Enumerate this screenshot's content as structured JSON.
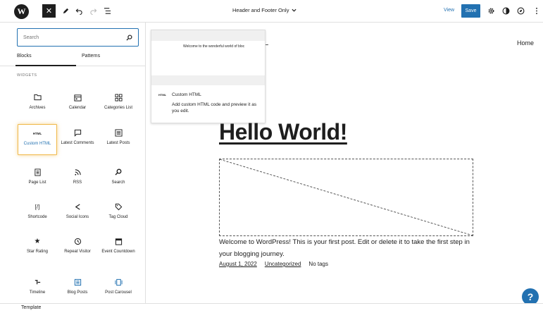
{
  "toolbar": {
    "logo_letter": "W",
    "close_symbol": "✕",
    "template_title": "Header and Footer Only",
    "view_label": "View",
    "save_label": "Save"
  },
  "inserter": {
    "search_placeholder": "Search",
    "tabs": [
      "Blocks",
      "Patterns"
    ],
    "section_title": "WIDGETS",
    "blocks": [
      {
        "label": "Archives",
        "icon": "folder-icon"
      },
      {
        "label": "Calendar",
        "icon": "calendar-icon"
      },
      {
        "label": "Categories List",
        "icon": "grid-icon"
      },
      {
        "label": "Custom HTML",
        "icon": "html-icon",
        "selected": true
      },
      {
        "label": "Latest Comments",
        "icon": "comment-icon"
      },
      {
        "label": "Latest Posts",
        "icon": "list-icon"
      },
      {
        "label": "Page List",
        "icon": "pages-icon"
      },
      {
        "label": "RSS",
        "icon": "rss-icon"
      },
      {
        "label": "Search",
        "icon": "search-icon"
      },
      {
        "label": "Shortcode",
        "icon": "shortcode-icon"
      },
      {
        "label": "Social Icons",
        "icon": "share-icon"
      },
      {
        "label": "Tag Cloud",
        "icon": "tag-icon"
      },
      {
        "label": "Star Rating",
        "icon": "star-icon"
      },
      {
        "label": "Repeat Visitor",
        "icon": "history-icon"
      },
      {
        "label": "Event Countdown",
        "icon": "event-icon"
      },
      {
        "label": "Timeline",
        "icon": "timeline-icon"
      },
      {
        "label": "Blog Posts",
        "icon": "posts-icon"
      },
      {
        "label": "Post Carousel",
        "icon": "carousel-icon"
      }
    ]
  },
  "preview": {
    "welcome_snippet": "Welcome to the wonderful world of bloc",
    "html_icon_text": "HTML",
    "title": "Custom HTML",
    "description": "Add custom HTML code and preview it as you edit."
  },
  "canvas": {
    "home_link": "Home",
    "heading": "Hello World!",
    "post_text": "Welcome to WordPress! This is your first post. Edit or delete it to take the first step in your blogging journey.",
    "date": "August 1, 2022",
    "category": "Uncategorized",
    "tags": "No tags"
  },
  "footer": {
    "label": "Template"
  },
  "help_symbol": "?",
  "colors": {
    "accent": "#2271b1",
    "selected_outline": "#f0b849"
  }
}
